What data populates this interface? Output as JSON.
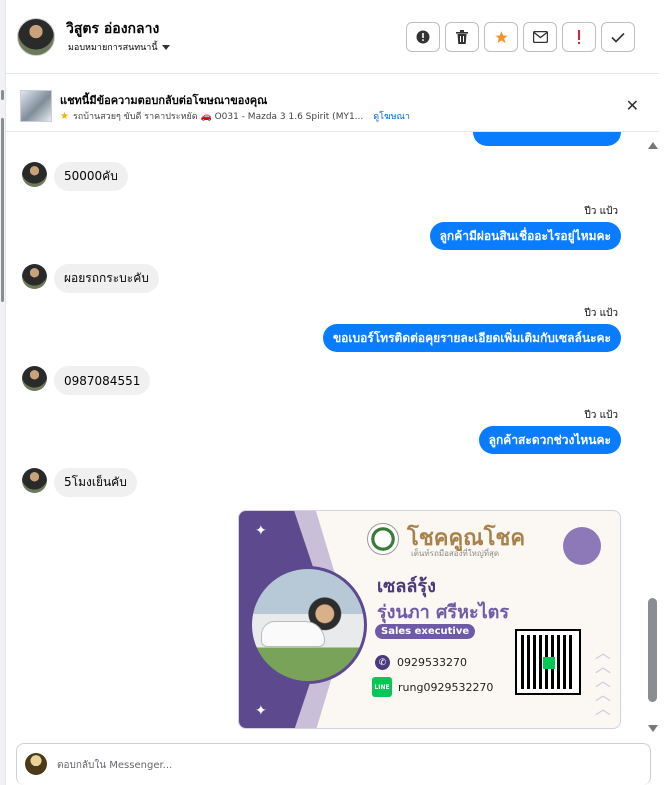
{
  "header": {
    "name": "วิสูตร อ่องกลาง",
    "assign_label": "มอบหมายการสนทนานี้",
    "actions": [
      {
        "name": "report-icon",
        "glyph": "!"
      },
      {
        "name": "trash-icon",
        "glyph": "🗑"
      },
      {
        "name": "star-icon",
        "glyph": "★"
      },
      {
        "name": "mail-icon",
        "glyph": "✉"
      },
      {
        "name": "spam-icon",
        "glyph": "!"
      },
      {
        "name": "check-icon",
        "glyph": "✓"
      }
    ]
  },
  "ad": {
    "title": "แชทนี้มีข้อความตอบกลับต่อโฆษณาของคุณ",
    "subtitle": "รถบ้านสวยๆ ขับดี ราคาประหยัด 🚗 O031 - Mazda 3 1.6 Spirit (MY1...",
    "link": "ดูโฆษณา"
  },
  "messages": {
    "m1": "50000คับ",
    "t2": "ปีว แป้ว",
    "m2": "ลูกค้ามีผ่อนสินเชื่ออะไรอยู่ไหมคะ",
    "m3": "ผอยรถกระบะคับ",
    "t4": "ปีว แป้ว",
    "m4": "ขอเบอร์โทรติดต่อคุยรายละเอียดเพิ่มเติมกับเซลล์นะคะ",
    "m5": "0987084551",
    "t6": "ปีว แป้ว",
    "m6": "ลูกค้าสะดวกช่วงไหนคะ",
    "m7": "5โมงเย็นคับ"
  },
  "card": {
    "brand": "โชคคูณโชค",
    "tagline": "เต็นท์รถมือสองที่ใหญ่ที่สุด",
    "nickname": "เซลล์รุ้ง",
    "fullname": "รุ่งนภา ศรีหะไตร",
    "position": "Sales executive",
    "phone": "0929533270",
    "line_label": "LINE",
    "line_id": "rung0929532270"
  },
  "composer": {
    "placeholder": "ตอบกลับใน Messenger..."
  },
  "colors": {
    "bubble_out": "#0a7cff",
    "bubble_in": "#f0f0f0",
    "card_purple": "#5d4a8e"
  }
}
